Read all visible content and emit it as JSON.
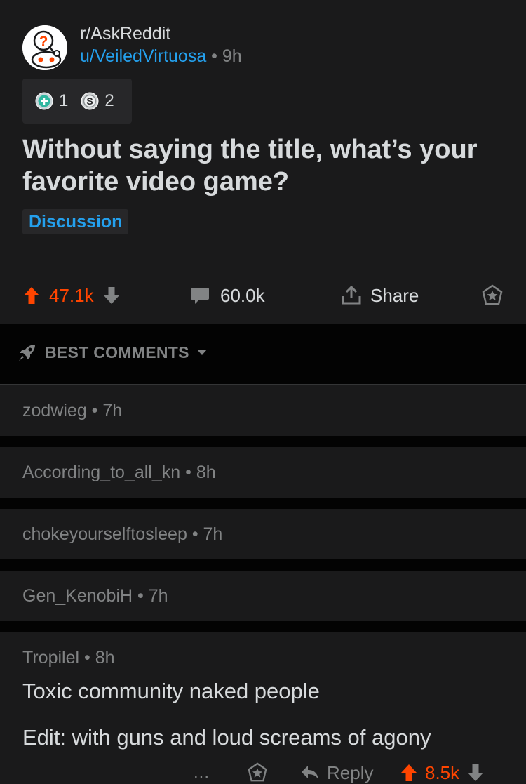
{
  "post": {
    "subreddit": "r/AskReddit",
    "username": "u/VeiledVirtuosa",
    "separator": " • ",
    "age": "9h",
    "awards": [
      {
        "icon": "helpful-award-icon",
        "count": "1"
      },
      {
        "icon": "silver-award-icon",
        "count": "2"
      }
    ],
    "title": "Without saying the title, what’s your favorite video game?",
    "flair": "Discussion",
    "upvotes": "47.1k",
    "comments": "60.0k",
    "share_label": "Share"
  },
  "sort": {
    "label": "BEST COMMENTS"
  },
  "collapsed_comments": [
    {
      "author": "zodwieg",
      "age": "7h"
    },
    {
      "author": "According_to_all_kn",
      "age": "8h"
    },
    {
      "author": "chokeyourselftosleep",
      "age": "7h"
    },
    {
      "author": "Gen_KenobiH",
      "age": "7h"
    }
  ],
  "comment": {
    "author": "Tropilel",
    "age": "8h",
    "body_line1": "Toxic community naked people",
    "body_line2": "Edit: with guns and loud screams of agony",
    "more": "...",
    "reply_label": "Reply",
    "upvotes": "8.5k"
  },
  "colors": {
    "accent_upvote": "#ff4500",
    "link_blue": "#24a0ed",
    "background": "#1a1a1b",
    "separator": "#030303"
  }
}
